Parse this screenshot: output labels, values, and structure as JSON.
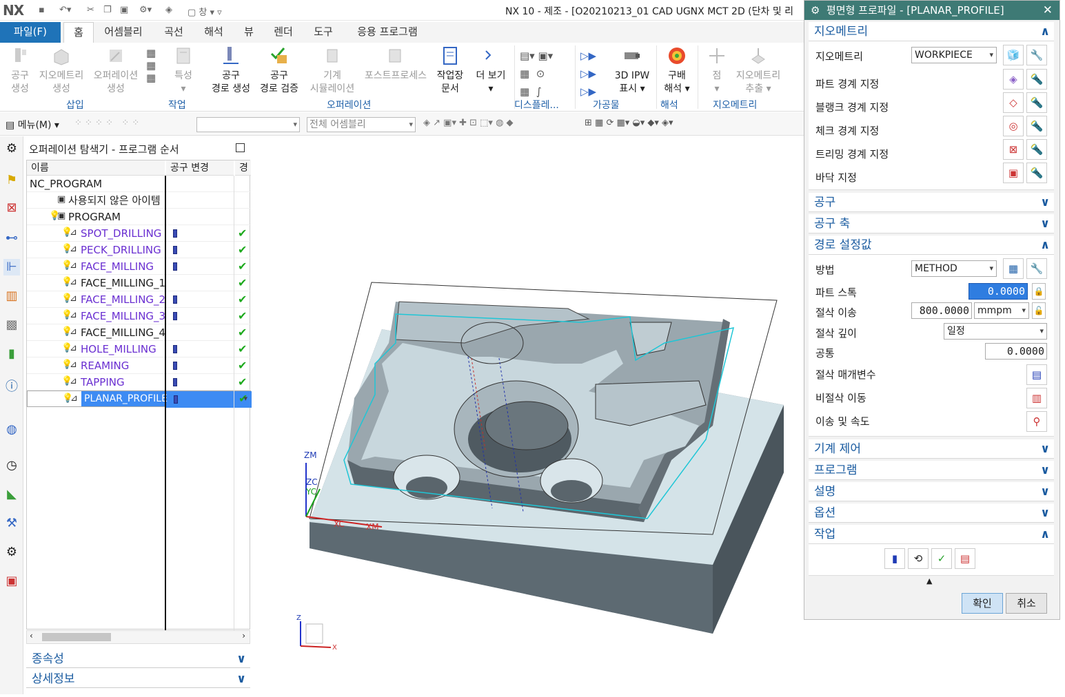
{
  "window": {
    "logo": "NX",
    "title": "NX 10 - 제조 - [O20210213_01 CAD UGNX MCT 2D (단차 및 리",
    "quick_window": "창"
  },
  "menu": {
    "file": "파일(F)",
    "tabs": [
      "홈",
      "어셈블리",
      "곡선",
      "해석",
      "뷰",
      "렌더",
      "도구",
      "응용 프로그램"
    ]
  },
  "ribbon": {
    "buttons": [
      {
        "l1": "공구",
        "l2": "생성",
        "dis": true
      },
      {
        "l1": "지오메트리",
        "l2": "생성",
        "dis": true
      },
      {
        "l1": "오퍼레이션",
        "l2": "생성",
        "dis": true
      },
      {
        "l1": "특성",
        "l2": "▾",
        "dis": true
      },
      {
        "l1": "공구",
        "l2": "경로 생성",
        "dis": false
      },
      {
        "l1": "공구",
        "l2": "경로 검증",
        "dis": false
      },
      {
        "l1": "기계",
        "l2": "시뮬레이션",
        "dis": true
      },
      {
        "l1": "포스트프로세스",
        "l2": "",
        "dis": true
      },
      {
        "l1": "작업장",
        "l2": "문서",
        "dis": false
      },
      {
        "l1": "더 보기",
        "l2": "▾",
        "dis": false
      },
      {
        "l1": "3D IPW",
        "l2": "표시 ▾",
        "dis": false
      },
      {
        "l1": "구배",
        "l2": "해석 ▾",
        "dis": false
      },
      {
        "l1": "점",
        "l2": "▾",
        "dis": true
      },
      {
        "l1": "지오메트리",
        "l2": "추출 ▾",
        "dis": true
      }
    ],
    "groups": [
      "삽입",
      "작업",
      "오퍼레이션",
      "디스플레...",
      "가공물",
      "해석",
      "지오메트리"
    ]
  },
  "cmdbar": {
    "menu": "메뉴(M)",
    "filter_placeholder": "",
    "assembly": "전체 어셈블리"
  },
  "navigator": {
    "title": "오퍼레이션 탐색기 - 프로그램 순서",
    "columns": [
      "이름",
      "공구 변경",
      "경"
    ],
    "rows": [
      {
        "name": "NC_PROGRAM",
        "indent": 0,
        "link": false,
        "tool": false,
        "check": false,
        "icon": ""
      },
      {
        "name": "사용되지 않은 아이템",
        "indent": 1,
        "link": false,
        "tool": false,
        "check": false,
        "icon": "folder"
      },
      {
        "name": "PROGRAM",
        "indent": 1,
        "link": false,
        "tool": false,
        "check": false,
        "icon": "folder"
      },
      {
        "name": "SPOT_DRILLING",
        "indent": 2,
        "link": true,
        "tool": true,
        "check": true,
        "icon": "op"
      },
      {
        "name": "PECK_DRILLING",
        "indent": 2,
        "link": true,
        "tool": true,
        "check": true,
        "icon": "op"
      },
      {
        "name": "FACE_MILLING",
        "indent": 2,
        "link": true,
        "tool": true,
        "check": true,
        "icon": "op"
      },
      {
        "name": "FACE_MILLING_1",
        "indent": 2,
        "link": false,
        "tool": false,
        "check": true,
        "icon": "op"
      },
      {
        "name": "FACE_MILLING_2",
        "indent": 2,
        "link": true,
        "tool": true,
        "check": true,
        "icon": "op"
      },
      {
        "name": "FACE_MILLING_3",
        "indent": 2,
        "link": true,
        "tool": true,
        "check": true,
        "icon": "op"
      },
      {
        "name": "FACE_MILLING_4",
        "indent": 2,
        "link": false,
        "tool": false,
        "check": true,
        "icon": "op"
      },
      {
        "name": "HOLE_MILLING",
        "indent": 2,
        "link": true,
        "tool": true,
        "check": true,
        "icon": "op"
      },
      {
        "name": "REAMING",
        "indent": 2,
        "link": true,
        "tool": true,
        "check": true,
        "icon": "op"
      },
      {
        "name": "TAPPING",
        "indent": 2,
        "link": true,
        "tool": true,
        "check": true,
        "icon": "op"
      },
      {
        "name": "PLANAR_PROFILE",
        "indent": 2,
        "link": false,
        "tool": true,
        "check": true,
        "icon": "op",
        "selected": true
      }
    ],
    "panels": [
      "종속성",
      "상세정보"
    ]
  },
  "viewport": {
    "axes": {
      "zm": "ZM",
      "zc": "ZC",
      "yc": "YC",
      "xc": "XC",
      "xm": "XM",
      "small_z": "Z",
      "small_x": "X"
    }
  },
  "dialog": {
    "title": "평면형 프로파일 - [PLANAR_PROFILE]",
    "geometry": {
      "header": "지오메트리",
      "label": "지오메트리",
      "value": "WORKPIECE",
      "rows": [
        "파트 경계 지정",
        "블랭크 경계 지정",
        "체크 경계 지정",
        "트리밍 경계 지정",
        "바닥 지정"
      ]
    },
    "tool": "공구",
    "tool_axis": "공구 축",
    "path": {
      "header": "경로 설정값",
      "method_label": "방법",
      "method_value": "METHOD",
      "stock_label": "파트 스톡",
      "stock_value": "0.0000",
      "feed_label": "절삭 이송",
      "feed_value": "800.0000",
      "feed_unit": "mmpm",
      "depth_label": "절삭 깊이",
      "depth_value": "일정",
      "common_label": "공통",
      "common_value": "0.0000",
      "cut_params": "절삭 매개변수",
      "non_cut": "비절삭 이동",
      "feeds_speeds": "이송 및 속도"
    },
    "machine": "기계 제어",
    "program": "프로그램",
    "description": "설명",
    "options": "옵션",
    "actions": "작업",
    "ok": "확인",
    "cancel": "취소"
  }
}
